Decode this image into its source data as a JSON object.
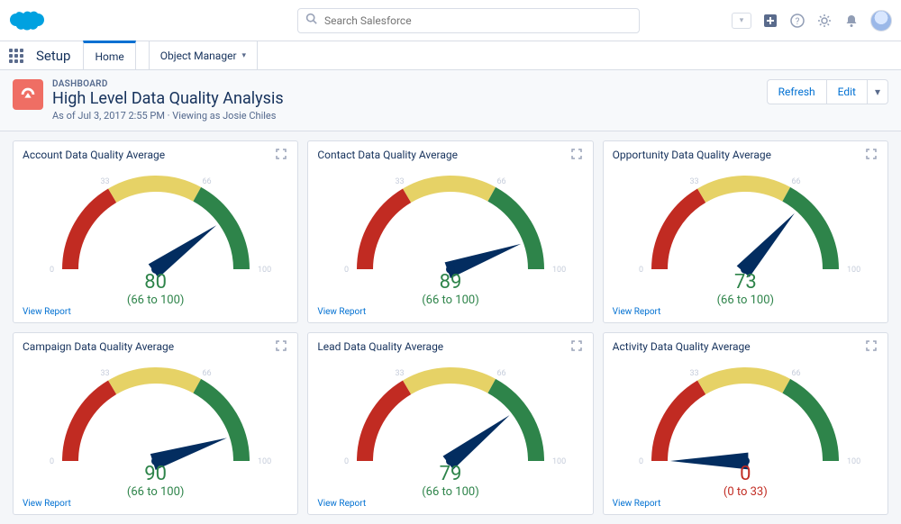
{
  "header": {
    "search_placeholder": "Search Salesforce",
    "app_name": "Setup",
    "tabs": [
      {
        "label": "Home",
        "active": true
      },
      {
        "label": "Object Manager",
        "active": false,
        "chevron": true
      }
    ]
  },
  "page": {
    "type_label": "DASHBOARD",
    "title": "High Level Data Quality Analysis",
    "meta": "As of Jul 3, 2017 2:55 PM · Viewing as Josie Chiles",
    "actions": {
      "refresh": "Refresh",
      "edit": "Edit"
    }
  },
  "chart_data": [
    {
      "type": "gauge",
      "title": "Account Data Quality Average",
      "value": 80,
      "min": 0,
      "max": 100,
      "bands": [
        33,
        66,
        100
      ],
      "range_label": "(66 to 100)",
      "status": "good",
      "link": "View Report"
    },
    {
      "type": "gauge",
      "title": "Contact Data Quality Average",
      "value": 89,
      "min": 0,
      "max": 100,
      "bands": [
        33,
        66,
        100
      ],
      "range_label": "(66 to 100)",
      "status": "good",
      "link": "View Report"
    },
    {
      "type": "gauge",
      "title": "Opportunity Data Quality Average",
      "value": 73,
      "min": 0,
      "max": 100,
      "bands": [
        33,
        66,
        100
      ],
      "range_label": "(66 to 100)",
      "status": "good",
      "link": "View Report"
    },
    {
      "type": "gauge",
      "title": "Campaign Data Quality Average",
      "value": 90,
      "min": 0,
      "max": 100,
      "bands": [
        33,
        66,
        100
      ],
      "range_label": "(66 to 100)",
      "status": "good",
      "link": "View Report"
    },
    {
      "type": "gauge",
      "title": "Lead Data Quality Average",
      "value": 79,
      "min": 0,
      "max": 100,
      "bands": [
        33,
        66,
        100
      ],
      "range_label": "(66 to 100)",
      "status": "good",
      "link": "View Report"
    },
    {
      "type": "gauge",
      "title": "Activity Data Quality Average",
      "value": 0,
      "min": 0,
      "max": 100,
      "bands": [
        33,
        66,
        100
      ],
      "range_label": "(0 to 33)",
      "status": "bad",
      "link": "View Report"
    }
  ]
}
